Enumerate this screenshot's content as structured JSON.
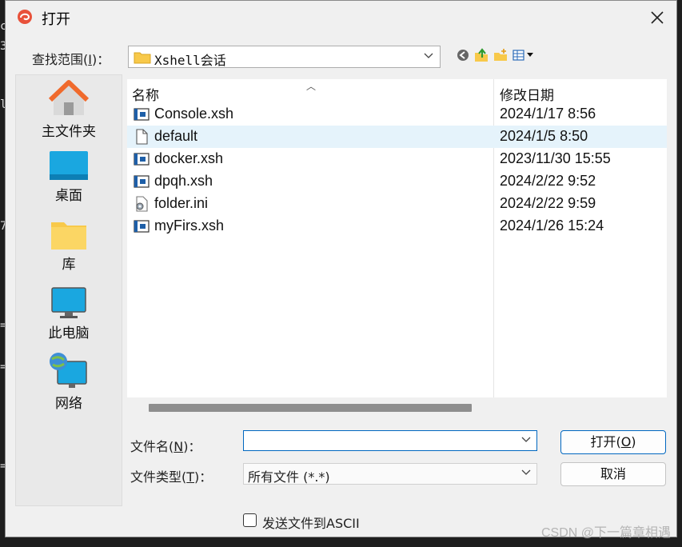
{
  "background": {
    "glyphs": [
      {
        "text": "c"
      },
      {
        "text": "3"
      },
      {
        "text": "l"
      },
      {
        "text": "7"
      },
      {
        "text": "="
      },
      {
        "text": "="
      },
      {
        "text": "="
      }
    ]
  },
  "dialog": {
    "title": "打开",
    "look_in": {
      "label_prefix": "查找范围(",
      "label_key": "I",
      "label_suffix": ")：",
      "value": "Xshell会话"
    },
    "toolbar": {
      "icons": [
        "back-icon",
        "up-folder-icon",
        "new-folder-icon",
        "view-menu-icon"
      ]
    },
    "places": [
      {
        "label": "主文件夹",
        "icon": "home-icon"
      },
      {
        "label": "桌面",
        "icon": "desktop-icon"
      },
      {
        "label": "库",
        "icon": "library-icon"
      },
      {
        "label": "此电脑",
        "icon": "computer-icon"
      },
      {
        "label": "网络",
        "icon": "network-icon"
      }
    ],
    "file_list": {
      "columns": {
        "name": "名称",
        "date": "修改日期"
      },
      "rows": [
        {
          "name": "Console.xsh",
          "date": "2024/1/17 8:56",
          "icon": "xsh-file-icon",
          "selected": false
        },
        {
          "name": "default",
          "date": "2024/1/5 8:50",
          "icon": "blank-file-icon",
          "selected": true
        },
        {
          "name": "docker.xsh",
          "date": "2023/11/30 15:55",
          "icon": "xsh-file-icon",
          "selected": false
        },
        {
          "name": "dpqh.xsh",
          "date": "2024/2/22 9:52",
          "icon": "xsh-file-icon",
          "selected": false
        },
        {
          "name": "folder.ini",
          "date": "2024/2/22 9:59",
          "icon": "ini-file-icon",
          "selected": false
        },
        {
          "name": "myFirs.xsh",
          "date": "2024/1/26 15:24",
          "icon": "xsh-file-icon",
          "selected": false
        }
      ]
    },
    "file_name": {
      "label_prefix": "文件名(",
      "label_key": "N",
      "label_suffix": ")：",
      "value": ""
    },
    "file_type": {
      "label_prefix": "文件类型(",
      "label_key": "T",
      "label_suffix": ")：",
      "value": "所有文件 (*.*)"
    },
    "buttons": {
      "open_prefix": "打开(",
      "open_key": "O",
      "open_suffix": ")",
      "cancel": "取消"
    },
    "ascii_checkbox": {
      "label": "发送文件到ASCII",
      "checked": false
    },
    "colors": {
      "accent": "#0067c0",
      "selection": "#e5f3fb"
    }
  },
  "watermark": "CSDN @下一篇章相遇"
}
